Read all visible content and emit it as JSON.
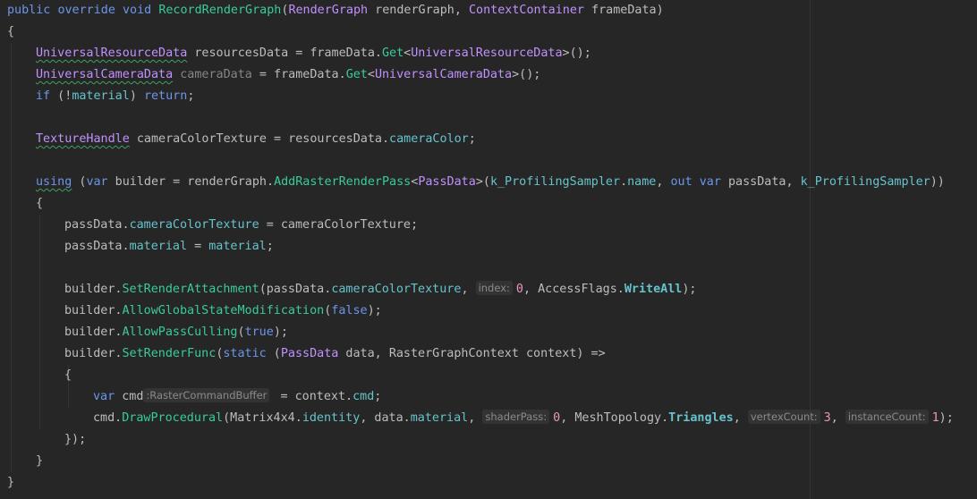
{
  "editor": {
    "lines": [
      {
        "indent": 0,
        "tokens": [
          {
            "t": "public",
            "c": "kw"
          },
          {
            "t": " "
          },
          {
            "t": "override",
            "c": "kw"
          },
          {
            "t": " "
          },
          {
            "t": "void",
            "c": "kw"
          },
          {
            "t": " "
          },
          {
            "t": "RecordRenderGraph",
            "c": "method"
          },
          {
            "t": "("
          },
          {
            "t": "RenderGraph",
            "c": "type"
          },
          {
            "t": " renderGraph, "
          },
          {
            "t": "ContextContainer",
            "c": "type"
          },
          {
            "t": " frameData)"
          }
        ]
      },
      {
        "indent": 0,
        "tokens": [
          {
            "t": "{"
          }
        ]
      },
      {
        "indent": 1,
        "tokens": [
          {
            "t": "UniversalResourceData",
            "c": "type",
            "warn": true
          },
          {
            "t": " resourcesData = frameData."
          },
          {
            "t": "Get",
            "c": "method"
          },
          {
            "t": "<"
          },
          {
            "t": "UniversalResourceData",
            "c": "type"
          },
          {
            "t": ">();"
          }
        ]
      },
      {
        "indent": 1,
        "tokens": [
          {
            "t": "UniversalCameraData",
            "c": "type",
            "warn": true
          },
          {
            "t": " "
          },
          {
            "t": "cameraData",
            "c": "dim"
          },
          {
            "t": " = frameData."
          },
          {
            "t": "Get",
            "c": "method"
          },
          {
            "t": "<"
          },
          {
            "t": "UniversalCameraData",
            "c": "type"
          },
          {
            "t": ">();"
          }
        ]
      },
      {
        "indent": 1,
        "tokens": [
          {
            "t": "if",
            "c": "kw"
          },
          {
            "t": " (!"
          },
          {
            "t": "material",
            "c": "field"
          },
          {
            "t": ") "
          },
          {
            "t": "return",
            "c": "kw"
          },
          {
            "t": ";"
          }
        ]
      },
      {
        "indent": 0,
        "tokens": []
      },
      {
        "indent": 1,
        "tokens": [
          {
            "t": "TextureHandle",
            "c": "type",
            "warn": true
          },
          {
            "t": " cameraColorTexture = resourcesData."
          },
          {
            "t": "cameraColor",
            "c": "field"
          },
          {
            "t": ";"
          }
        ]
      },
      {
        "indent": 0,
        "tokens": []
      },
      {
        "indent": 1,
        "tokens": [
          {
            "t": "using",
            "c": "kw",
            "warn": true
          },
          {
            "t": " ("
          },
          {
            "t": "var",
            "c": "kw"
          },
          {
            "t": " builder = renderGraph."
          },
          {
            "t": "AddRasterRenderPass",
            "c": "method"
          },
          {
            "t": "<"
          },
          {
            "t": "PassData",
            "c": "type"
          },
          {
            "t": ">("
          },
          {
            "t": "k_ProfilingSampler",
            "c": "field"
          },
          {
            "t": "."
          },
          {
            "t": "name",
            "c": "field"
          },
          {
            "t": ", "
          },
          {
            "t": "out",
            "c": "kw"
          },
          {
            "t": " "
          },
          {
            "t": "var",
            "c": "kw"
          },
          {
            "t": " passData, "
          },
          {
            "t": "k_ProfilingSampler",
            "c": "field"
          },
          {
            "t": "))"
          }
        ]
      },
      {
        "indent": 1,
        "tokens": [
          {
            "t": "{"
          }
        ]
      },
      {
        "indent": 2,
        "tokens": [
          {
            "t": "passData."
          },
          {
            "t": "cameraColorTexture",
            "c": "field"
          },
          {
            "t": " = cameraColorTexture;"
          }
        ]
      },
      {
        "indent": 2,
        "tokens": [
          {
            "t": "passData."
          },
          {
            "t": "material",
            "c": "field"
          },
          {
            "t": " = "
          },
          {
            "t": "material",
            "c": "field"
          },
          {
            "t": ";"
          }
        ]
      },
      {
        "indent": 0,
        "tokens": []
      },
      {
        "indent": 2,
        "tokens": [
          {
            "t": "builder."
          },
          {
            "t": "SetRenderAttachment",
            "c": "method"
          },
          {
            "t": "(passData."
          },
          {
            "t": "cameraColorTexture",
            "c": "field"
          },
          {
            "t": ", "
          },
          {
            "hint": "index:"
          },
          {
            "t": "0",
            "c": "num"
          },
          {
            "t": ", AccessFlags."
          },
          {
            "t": "WriteAll",
            "c": "bold"
          },
          {
            "t": ");"
          }
        ]
      },
      {
        "indent": 2,
        "tokens": [
          {
            "t": "builder."
          },
          {
            "t": "AllowGlobalStateModification",
            "c": "method"
          },
          {
            "t": "("
          },
          {
            "t": "false",
            "c": "kw"
          },
          {
            "t": ");"
          }
        ]
      },
      {
        "indent": 2,
        "tokens": [
          {
            "t": "builder."
          },
          {
            "t": "AllowPassCulling",
            "c": "method"
          },
          {
            "t": "("
          },
          {
            "t": "true",
            "c": "kw"
          },
          {
            "t": ");"
          }
        ]
      },
      {
        "indent": 2,
        "tokens": [
          {
            "t": "builder."
          },
          {
            "t": "SetRenderFunc",
            "c": "method"
          },
          {
            "t": "("
          },
          {
            "t": "static",
            "c": "kw"
          },
          {
            "t": " ("
          },
          {
            "t": "PassData",
            "c": "type"
          },
          {
            "t": " data, "
          },
          {
            "t": "RasterGraphContext"
          },
          {
            "t": " context) =>"
          }
        ]
      },
      {
        "indent": 2,
        "tokens": [
          {
            "t": "{"
          }
        ]
      },
      {
        "indent": 3,
        "tokens": [
          {
            "t": "var",
            "c": "kw"
          },
          {
            "t": " cmd"
          },
          {
            "hint": ":RasterCommandBuffer"
          },
          {
            "t": " = context."
          },
          {
            "t": "cmd",
            "c": "field"
          },
          {
            "t": ";"
          }
        ]
      },
      {
        "indent": 3,
        "tokens": [
          {
            "t": "cmd."
          },
          {
            "t": "DrawProcedural",
            "c": "method"
          },
          {
            "t": "(Matrix4x4."
          },
          {
            "t": "identity",
            "c": "field"
          },
          {
            "t": ", data."
          },
          {
            "t": "material",
            "c": "field"
          },
          {
            "t": ", "
          },
          {
            "hint": "shaderPass:"
          },
          {
            "t": "0",
            "c": "num"
          },
          {
            "t": ", MeshTopology."
          },
          {
            "t": "Triangles",
            "c": "bold"
          },
          {
            "t": ", "
          },
          {
            "hint": "vertexCount:"
          },
          {
            "t": "3",
            "c": "num"
          },
          {
            "t": ", "
          },
          {
            "hint": "instanceCount:"
          },
          {
            "t": "1",
            "c": "num"
          },
          {
            "t": ");"
          }
        ]
      },
      {
        "indent": 2,
        "tokens": [
          {
            "t": "});"
          }
        ]
      },
      {
        "indent": 1,
        "tokens": [
          {
            "t": "}"
          }
        ]
      },
      {
        "indent": 0,
        "tokens": [
          {
            "t": "}"
          }
        ]
      }
    ]
  }
}
